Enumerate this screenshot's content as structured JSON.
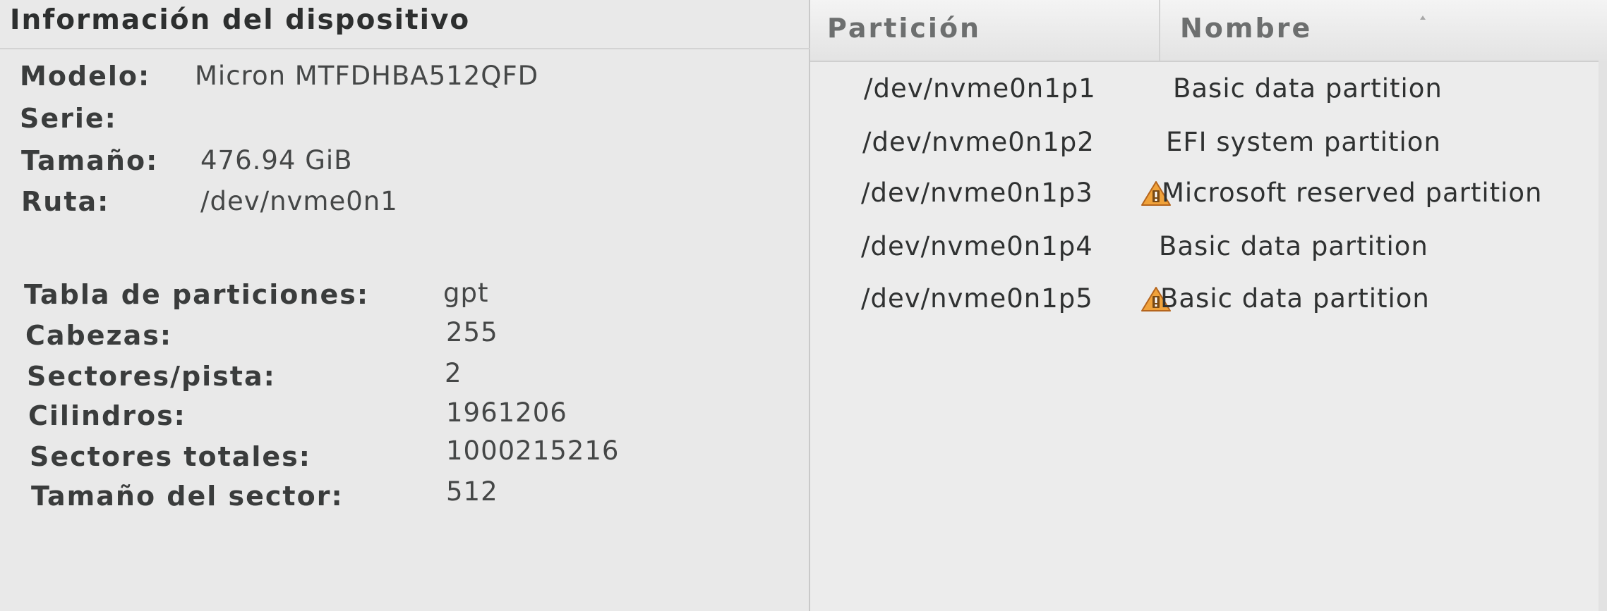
{
  "device_info": {
    "title": "Información del dispositivo",
    "model_label": "Modelo:",
    "model_value": "Micron MTFDHBA512QFD",
    "serial_label": "Serie:",
    "serial_value": "",
    "size_label": "Tamaño:",
    "size_value": "476.94 GiB",
    "path_label": "Ruta:",
    "path_value": "/dev/nvme0n1",
    "partition_table_label": "Tabla de particiones:",
    "partition_table_value": "gpt",
    "heads_label": "Cabezas:",
    "heads_value": "255",
    "sectors_track_label": "Sectores/pista:",
    "sectors_track_value": "2",
    "cylinders_label": "Cilindros:",
    "cylinders_value": "1961206",
    "total_sectors_label": "Sectores totales:",
    "total_sectors_value": "1000215216",
    "sector_size_label": "Tamaño del sector:",
    "sector_size_value": "512"
  },
  "partitions": {
    "columns": [
      "Partición",
      "Nombre"
    ],
    "rows": [
      {
        "partition": "/dev/nvme0n1p1",
        "name": "Basic data partition",
        "warning": false
      },
      {
        "partition": "/dev/nvme0n1p2",
        "name": "EFI system partition",
        "warning": false
      },
      {
        "partition": "/dev/nvme0n1p3",
        "name": "Microsoft reserved partition",
        "warning": true
      },
      {
        "partition": "/dev/nvme0n1p4",
        "name": "Basic data partition",
        "warning": false
      },
      {
        "partition": "/dev/nvme0n1p5",
        "name": "Basic data partition",
        "warning": true
      }
    ],
    "warning_icon": "warning-triangle-icon"
  },
  "colors": {
    "background": "#e9e9e9",
    "text": "#3a3c3c",
    "header_text": "#6d6f6f",
    "warning_fill": "#f0a23a",
    "warning_border": "#b5651d"
  }
}
